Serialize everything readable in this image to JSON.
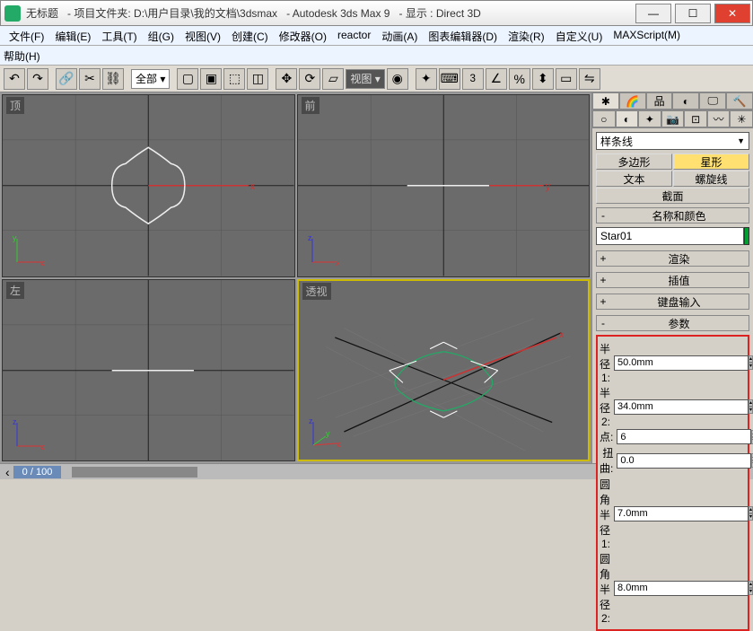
{
  "title": {
    "untitled": "无标题",
    "project": "- 项目文件夹: D:\\用户目录\\我的文档\\3dsmax",
    "app": "- Autodesk 3ds Max 9",
    "display": "- 显示 : Direct 3D"
  },
  "menu": {
    "file": "文件(F)",
    "edit": "编辑(E)",
    "tools": "工具(T)",
    "group": "组(G)",
    "views": "视图(V)",
    "create": "创建(C)",
    "modifiers": "修改器(O)",
    "reactor": "reactor",
    "animation": "动画(A)",
    "graph": "图表编辑器(D)",
    "render": "渲染(R)",
    "customize": "自定义(U)",
    "maxscript": "MAXScript(M)",
    "help": "帮助(H)"
  },
  "toolbar": {
    "all": "全部",
    "view": "视图"
  },
  "viewports": {
    "top": "顶",
    "front": "前",
    "left": "左",
    "persp": "透视"
  },
  "panel": {
    "dropdown": "样条线",
    "btns": {
      "poly": "多边形",
      "star": "星形",
      "text": "文本",
      "helix": "螺旋线",
      "section": "截面"
    },
    "rollouts": {
      "name": "名称和颜色",
      "render": "渲染",
      "interp": "插值",
      "keyboard": "键盘输入",
      "params": "参数"
    },
    "objname": "Star01",
    "params": {
      "r1_label": "半径 1:",
      "r1": "50.0mm",
      "r2_label": "半径 2:",
      "r2": "34.0mm",
      "pts_label": "点:",
      "pts": "6",
      "dist_label": "扭曲:",
      "dist": "0.0",
      "fr1_label": "圆角半径 1:",
      "fr1": "7.0mm",
      "fr2_label": "圆角半径 2:",
      "fr2": "8.0mm"
    }
  },
  "status": {
    "frame": "0  /  100"
  }
}
